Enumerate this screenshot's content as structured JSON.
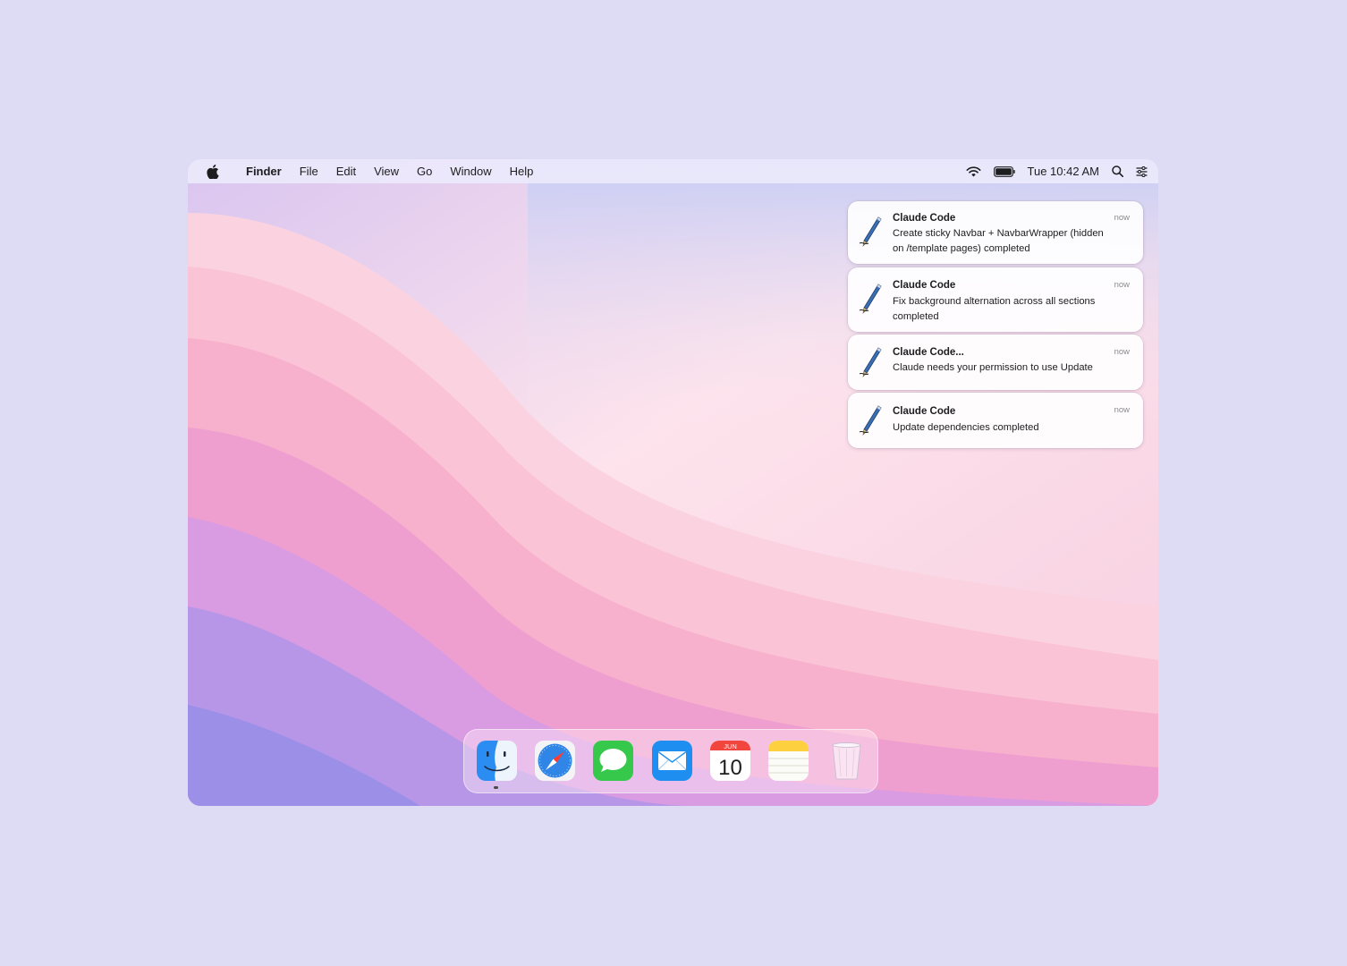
{
  "menubar": {
    "apple_icon": "apple-logo-icon",
    "app_name": "Finder",
    "menus": [
      "File",
      "Edit",
      "View",
      "Go",
      "Window",
      "Help"
    ],
    "status_icons": [
      "wifi-icon",
      "battery-icon",
      "search-icon",
      "control-center-icon"
    ],
    "clock": "Tue 10:42 AM"
  },
  "notifications": [
    {
      "title": "Claude Code",
      "body": "Create sticky Navbar + NavbarWrapper (hidden on /template pages) completed",
      "time": "now",
      "icon": "script-editor-icon"
    },
    {
      "title": "Claude Code",
      "body": "Fix background alternation across all sections completed",
      "time": "now",
      "icon": "script-editor-icon"
    },
    {
      "title": "Claude Code...",
      "body": "Claude needs your permission to use Update",
      "time": "now",
      "icon": "script-editor-icon"
    },
    {
      "title": "Claude Code",
      "body": "Update dependencies completed",
      "time": "now",
      "icon": "script-editor-icon"
    }
  ],
  "dock": {
    "apps": [
      "finder-icon",
      "safari-icon",
      "messages-icon",
      "mail-icon",
      "calendar-icon",
      "notes-icon",
      "trash-icon"
    ],
    "calendar": {
      "month": "JUN",
      "day": "10"
    }
  },
  "colors": {
    "page_background": "#dedcf5",
    "menubar_background": "#eceafc",
    "notification_background": "#ffffff"
  }
}
